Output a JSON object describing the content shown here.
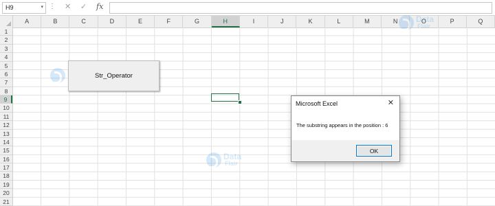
{
  "formula_bar": {
    "name_box": "H9",
    "cancel_glyph": "✕",
    "enter_glyph": "✓",
    "function_glyph": "fx",
    "formula": ""
  },
  "columns": [
    "A",
    "B",
    "C",
    "D",
    "E",
    "F",
    "G",
    "H",
    "I",
    "J",
    "K",
    "L",
    "M",
    "N",
    "O",
    "P",
    "Q"
  ],
  "rows": [
    "1",
    "2",
    "3",
    "4",
    "5",
    "6",
    "7",
    "8",
    "9",
    "10",
    "11",
    "12",
    "13",
    "14",
    "15",
    "16",
    "17",
    "18",
    "19",
    "20",
    "21"
  ],
  "selected_column": "H",
  "selected_row": "9",
  "macro_button": {
    "label": "Str_Operator"
  },
  "watermark": {
    "line1": "Data",
    "line2": "Flair"
  },
  "dialog": {
    "title": "Microsoft Excel",
    "message": "The substring appears in the position : 6",
    "ok_label": "OK",
    "close_glyph": "✕"
  },
  "colors": {
    "accent": "#217346",
    "button_focus": "#0078d7"
  }
}
